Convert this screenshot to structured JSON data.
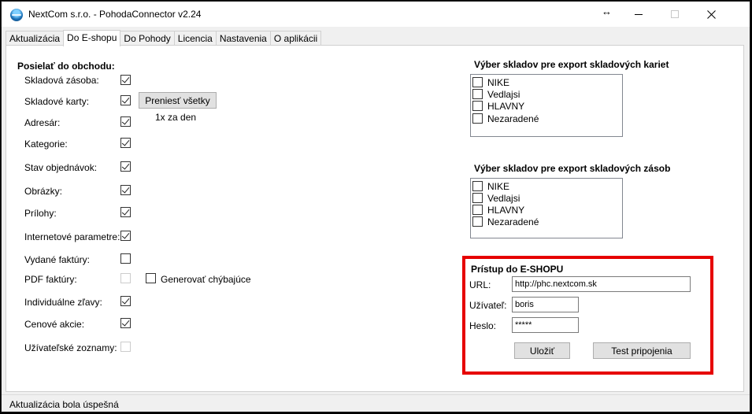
{
  "window": {
    "title": "NextCom s.r.o. - PohodaConnector v2.24",
    "resize_glyph": "↔"
  },
  "tabs": [
    {
      "label": "Aktualizácia"
    },
    {
      "label": "Do E-shopu"
    },
    {
      "label": "Do Pohody"
    },
    {
      "label": "Licencia"
    },
    {
      "label": "Nastavenia"
    },
    {
      "label": "O aplikácii"
    }
  ],
  "send": {
    "title": "Posielať do obchodu:",
    "items": [
      {
        "label": "Skladová zásoba:",
        "checked": true,
        "disabled": false
      },
      {
        "label": "Skladové karty:",
        "checked": true,
        "disabled": false
      },
      {
        "label": "Adresár:",
        "checked": true,
        "disabled": false
      },
      {
        "label": "Kategorie:",
        "checked": true,
        "disabled": false
      },
      {
        "label": "Stav objednávok:",
        "checked": true,
        "disabled": false
      },
      {
        "label": "Obrázky:",
        "checked": true,
        "disabled": false
      },
      {
        "label": "Prílohy:",
        "checked": true,
        "disabled": false
      },
      {
        "label": "Internetové parametre:",
        "checked": true,
        "disabled": false
      },
      {
        "label": "Vydané faktúry:",
        "checked": false,
        "disabled": false
      },
      {
        "label": "PDF faktúry:",
        "checked": false,
        "disabled": true
      },
      {
        "label": "Individuálne zľavy:",
        "checked": true,
        "disabled": false
      },
      {
        "label": "Cenové akcie:",
        "checked": true,
        "disabled": false
      },
      {
        "label": "Užívateľské zoznamy:",
        "checked": false,
        "disabled": true
      }
    ],
    "transfer_all_label": "Preniesť všetky",
    "frequency_label": "1x za den",
    "generate_missing_label": "Generovať chýbajúce"
  },
  "stock_cards": {
    "title": "Výber skladov pre export skladových kariet",
    "items": [
      "NIKE",
      "Vedlajsi",
      "HLAVNY",
      "Nezaradené"
    ]
  },
  "stock_levels": {
    "title": "Výber skladov pre export skladových zásob",
    "items": [
      "NIKE",
      "Vedlajsi",
      "HLAVNY",
      "Nezaradené"
    ]
  },
  "eshop_access": {
    "title": "Prístup do E-SHOPU",
    "url_label": "URL:",
    "url_value": "http://phc.nextcom.sk",
    "user_label": "Užívateľ:",
    "user_value": "boris",
    "password_label": "Heslo:",
    "password_value": "*****",
    "save_label": "Uložiť",
    "test_label": "Test pripojenia",
    "highlight_color": "#e60000"
  },
  "status": {
    "text": "Aktualizácia bola úspešná"
  }
}
